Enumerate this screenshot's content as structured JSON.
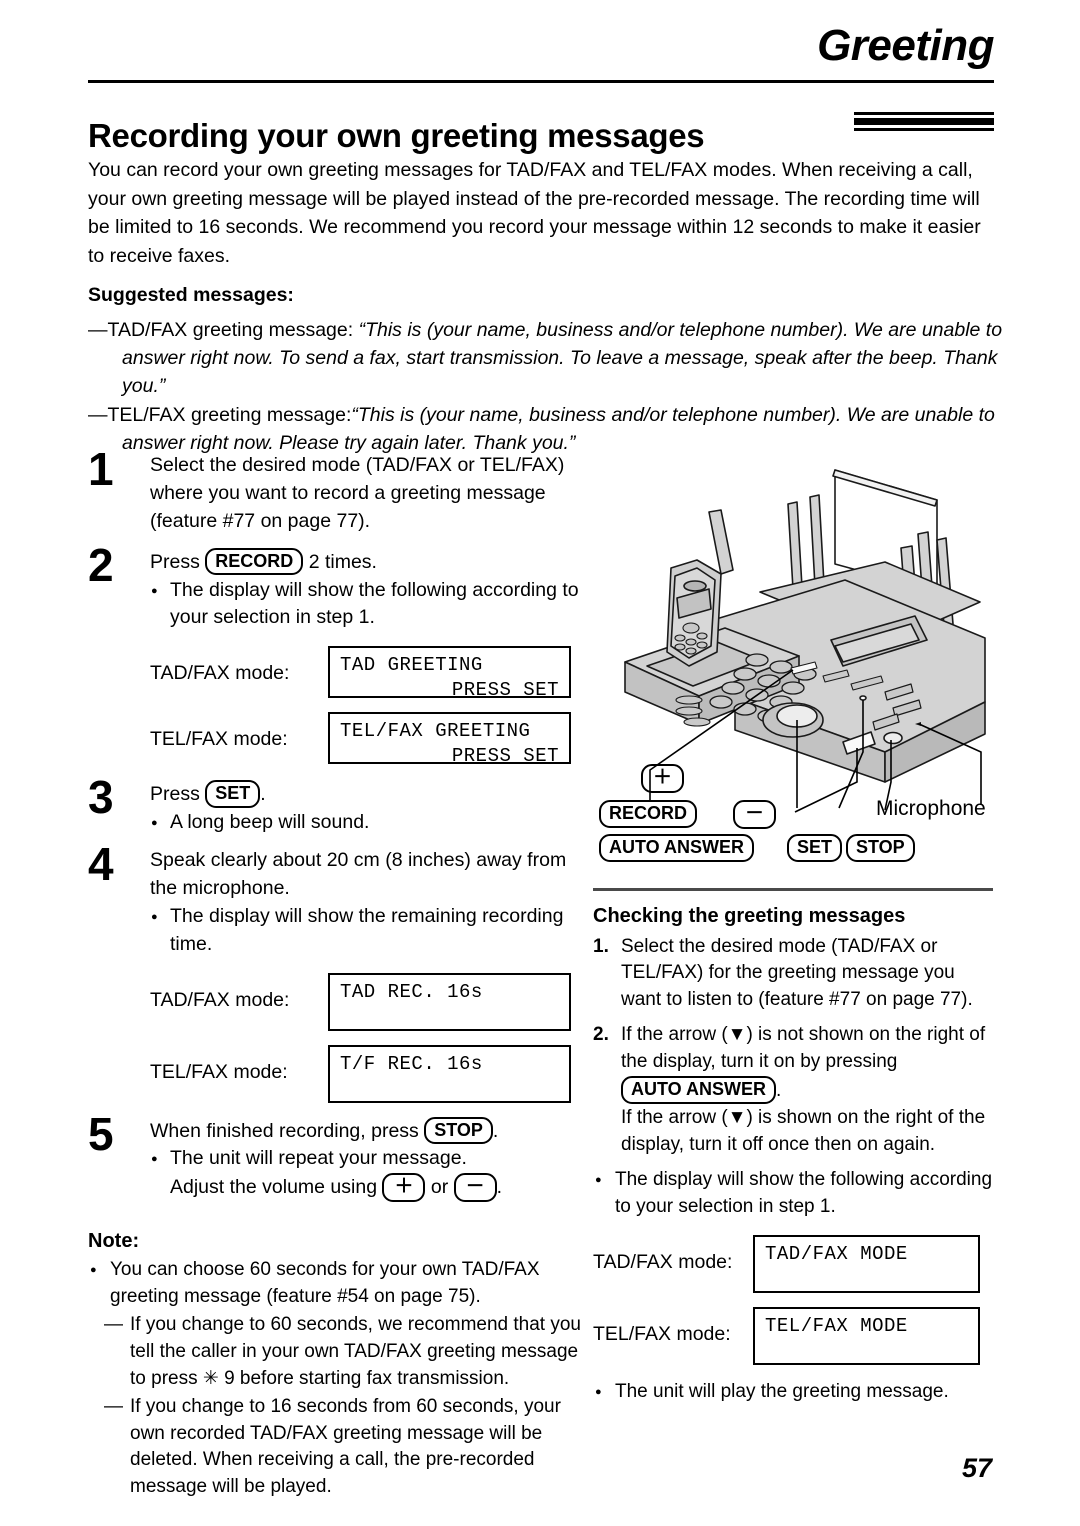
{
  "header": {
    "chapter_tab": "Greeting",
    "page_title": "Recording your own greeting messages"
  },
  "intro": {
    "paragraph": "You can record your own greeting messages for TAD/FAX and TEL/FAX modes. When receiving a call, your own greeting message will be played instead of the pre-recorded message. The recording time will be limited to 16 seconds. We recommend you record your message within 12 seconds to make it easier to receive faxes.",
    "suggested_heading": "Suggested messages:",
    "suggested": [
      {
        "dash": "—",
        "lead": "TAD/FAX greeting message: ",
        "quote": "“This is (your name, business and/or telephone number). We are unable to answer right now. To send a fax, start transmission. To leave a message, speak after the beep. Thank you.”"
      },
      {
        "dash": "—",
        "lead": "TEL/FAX greeting message:",
        "quote": "“This is (your name, business and/or telephone number). We are unable to answer right now. Please try again later. Thank you.”"
      }
    ]
  },
  "steps": {
    "step1": {
      "num": "1",
      "text": "Select the desired mode (TAD/FAX or TEL/FAX) where you want to record a greeting message (feature #77 on page 77)."
    },
    "step2": {
      "num": "2",
      "lead_before": "Press ",
      "key": "RECORD",
      "lead_after": " 2 times.",
      "bullet": "The display will show the following according to your selection in step 1.",
      "displays": [
        {
          "label": "TAD/FAX mode:",
          "line1": "TAD GREETING",
          "line2": "PRESS SET"
        },
        {
          "label": "TEL/FAX mode:",
          "line1": "TEL/FAX GREETING",
          "line2": "PRESS SET"
        }
      ]
    },
    "step3": {
      "num": "3",
      "lead_before": "Press ",
      "key": "SET",
      "lead_after": ".",
      "bullet": "A long beep will sound."
    },
    "step4": {
      "num": "4",
      "text": "Speak clearly about 20 cm (8 inches) away from the microphone.",
      "bullet": "The display will show the remaining recording time.",
      "displays": [
        {
          "label": "TAD/FAX mode:",
          "line1": "TAD    REC.    16s"
        },
        {
          "label": "TEL/FAX mode:",
          "line1": "T/F    REC.    16s"
        }
      ]
    },
    "step5": {
      "num": "5",
      "lead_before": "When finished recording, press ",
      "key": "STOP",
      "lead_after": ".",
      "bullet_line1": "The unit will repeat your message.",
      "bullet_line2_before": "Adjust the volume using ",
      "key_plus": "＋",
      "bullet_line2_mid": " or ",
      "key_minus": "－",
      "bullet_line2_after": "."
    }
  },
  "note": {
    "heading": "Note:",
    "items": [
      "You can choose 60 seconds for your own TAD/FAX greeting message (feature #54 on page 75)."
    ],
    "subitems": [
      "If you change to 60 seconds, we recommend that you tell the caller in your own TAD/FAX greeting message to press  ✳ 9 before starting fax transmission.",
      "If you change to 16 seconds from 60 seconds, your own recorded TAD/FAX greeting message will be deleted. When receiving a call, the pre-recorded message will be played."
    ]
  },
  "illustration": {
    "callouts": {
      "plus": "＋",
      "record": "RECORD",
      "minus": "－",
      "auto_answer": "AUTO ANSWER",
      "set": "SET",
      "stop": "STOP",
      "microphone": "Microphone"
    }
  },
  "checking": {
    "heading": "Checking the greeting messages",
    "items": [
      {
        "n": "1.",
        "text": "Select the desired mode (TAD/FAX or TEL/FAX) for the greeting message you want to listen to (feature #77 on page 77)."
      }
    ],
    "item2": {
      "n": "2.",
      "text_before": "If the arrow (▼) is not shown on the right of the display, turn it on by pressing ",
      "key": "AUTO ANSWER",
      "text_after": ".",
      "text_more": "If the arrow (▼) is shown on the right of the display, turn it off once then on again."
    },
    "bullet": "The display will show the following according to your selection in step 1.",
    "displays": [
      {
        "label": "TAD/FAX mode:",
        "line1": "TAD/FAX MODE"
      },
      {
        "label": "TEL/FAX mode:",
        "line1": "TEL/FAX MODE"
      }
    ],
    "final_bullet": "The unit will play the greeting message."
  },
  "footer": {
    "page_number": "57"
  }
}
